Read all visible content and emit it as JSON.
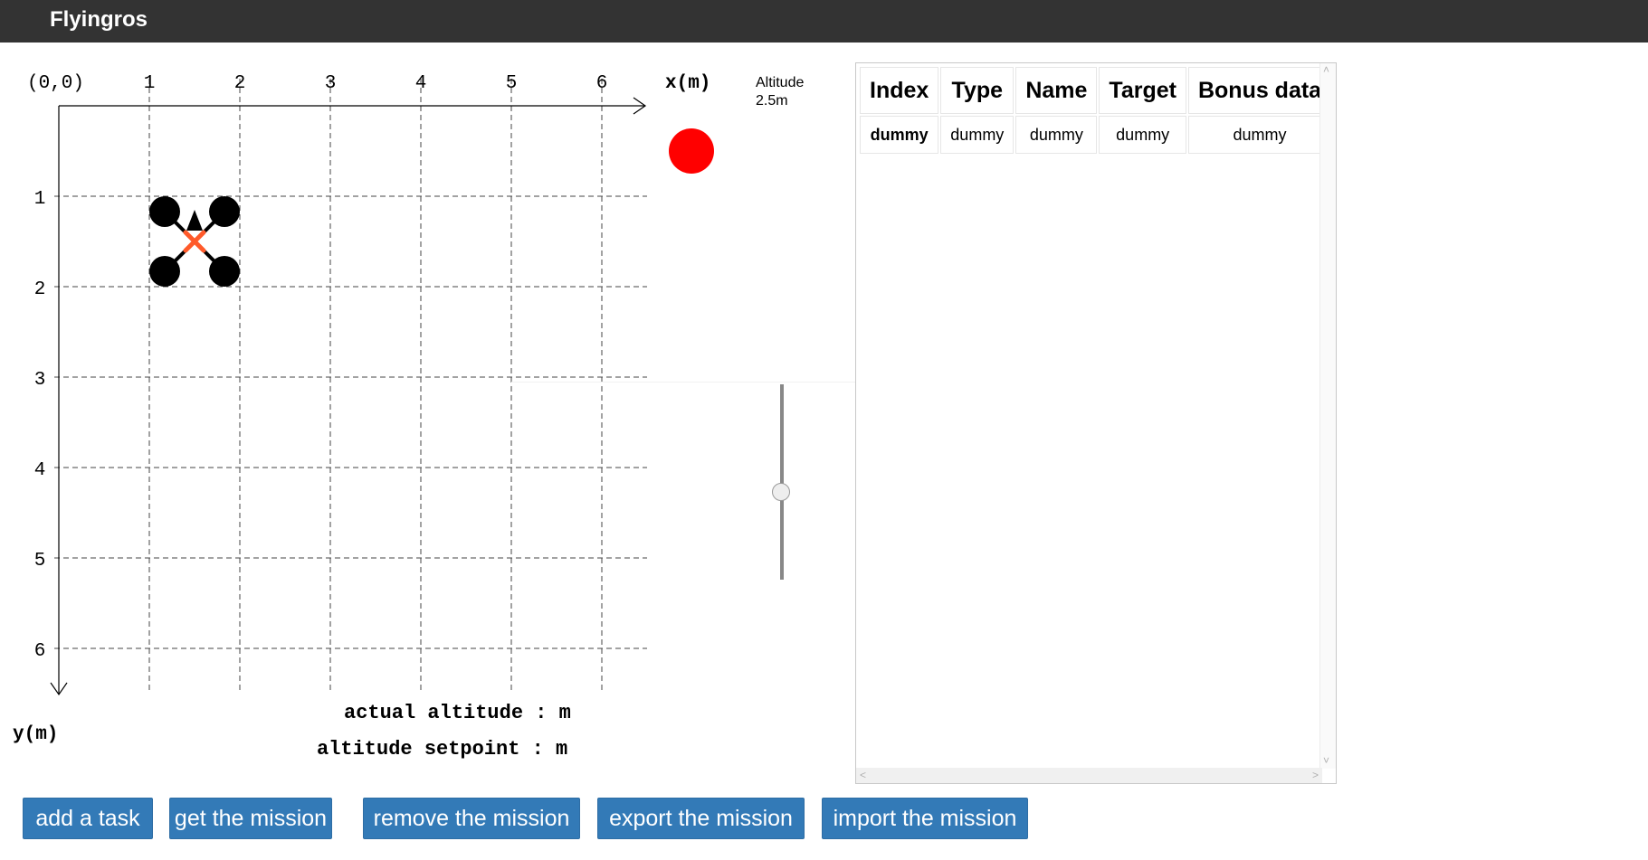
{
  "app": {
    "title": "Flyingros"
  },
  "map": {
    "origin_label": "(0,0)",
    "x_ticks": [
      "1",
      "2",
      "3",
      "4",
      "5",
      "6"
    ],
    "y_ticks": [
      "1",
      "2",
      "3",
      "4",
      "5",
      "6"
    ],
    "x_axis_label": "x(m)",
    "y_axis_label": "y(m)",
    "drone": {
      "x": 1.5,
      "y": 1.5,
      "heading": "up",
      "icon": "quadcopter-icon",
      "marker_color": "#ff5a2a"
    }
  },
  "status": {
    "indicator_color": "#ff0000"
  },
  "altitude": {
    "label": "Altitude",
    "value": "2.5m",
    "actual_label": "actual altitude : m",
    "setpoint_label": "altitude setpoint : m",
    "slider_level": 0.55
  },
  "table": {
    "headers": [
      "Index",
      "Type",
      "Name",
      "Target",
      "Bonus data"
    ],
    "rows": [
      [
        "dummy",
        "dummy",
        "dummy",
        "dummy",
        "dummy"
      ]
    ]
  },
  "buttons": {
    "add_task": "add a task",
    "get_mission": "get the mission",
    "remove_mission": "remove the mission",
    "export_mission": "export the mission",
    "import_mission": "import the mission",
    "color": "#337ab7"
  }
}
